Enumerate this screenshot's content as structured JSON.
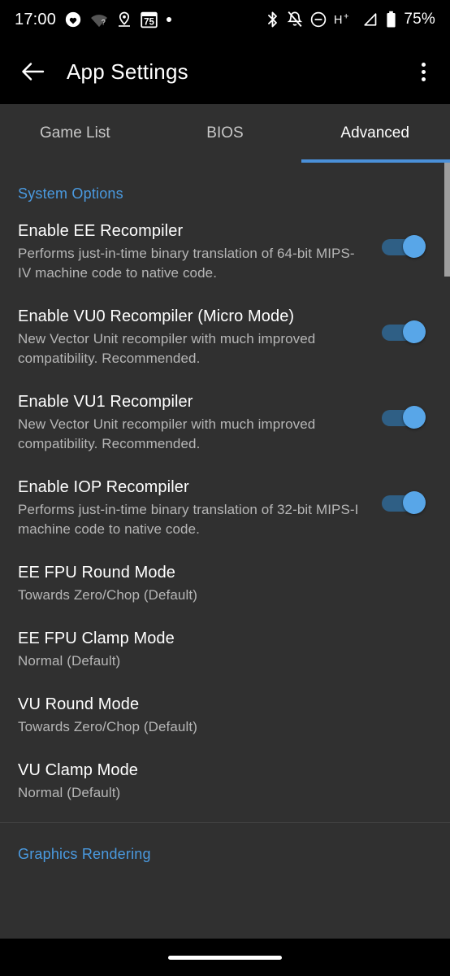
{
  "status_bar": {
    "time": "17:00",
    "battery_percent": "75%",
    "wifi_badge": "?",
    "calendar_day": "75",
    "network_type": "H+",
    "icons_left": [
      "heart-icon",
      "wifi-unknown-icon",
      "location-pin-icon",
      "calendar-icon",
      "dot-icon"
    ],
    "icons_right": [
      "bluetooth-icon",
      "notifications-muted-icon",
      "do-not-disturb-icon",
      "network-type-label",
      "signal-icon",
      "battery-icon"
    ]
  },
  "app_bar": {
    "back_label": "back",
    "title": "App Settings",
    "overflow_label": "more options"
  },
  "tabs": [
    {
      "label": "Game List",
      "active": false
    },
    {
      "label": "BIOS",
      "active": false
    },
    {
      "label": "Advanced",
      "active": true
    }
  ],
  "sections": [
    {
      "header": "System Options",
      "rows": [
        {
          "title": "Enable EE Recompiler",
          "subtitle": "Performs just-in-time binary translation of 64-bit MIPS-IV machine code to native code.",
          "control": "toggle",
          "value": "on"
        },
        {
          "title": "Enable VU0 Recompiler (Micro Mode)",
          "subtitle": "New Vector Unit recompiler with much improved compatibility. Recommended.",
          "control": "toggle",
          "value": "on"
        },
        {
          "title": "Enable VU1 Recompiler",
          "subtitle": "New Vector Unit recompiler with much improved compatibility. Recommended.",
          "control": "toggle",
          "value": "on"
        },
        {
          "title": "Enable IOP Recompiler",
          "subtitle": "Performs just-in-time binary translation of 32-bit MIPS-I machine code to native code.",
          "control": "toggle",
          "value": "on"
        },
        {
          "title": "EE FPU Round Mode",
          "subtitle": "Towards Zero/Chop (Default)",
          "control": "none",
          "value": ""
        },
        {
          "title": "EE FPU Clamp Mode",
          "subtitle": "Normal (Default)",
          "control": "none",
          "value": ""
        },
        {
          "title": "VU Round Mode",
          "subtitle": "Towards Zero/Chop (Default)",
          "control": "none",
          "value": ""
        },
        {
          "title": "VU Clamp Mode",
          "subtitle": "Normal (Default)",
          "control": "none",
          "value": ""
        }
      ]
    },
    {
      "header": "Graphics Rendering",
      "rows": []
    }
  ],
  "colors": {
    "accent": "#4a9ae0",
    "tab_indicator": "#4a90d9",
    "toggle_thumb_on": "#58a6e8",
    "toggle_track_on": "#2f5f85",
    "surface": "#303030",
    "app_bar": "#000000",
    "title_text": "#ffffff",
    "secondary_text": "#b6b6b6",
    "scrollbar": "#9e9e9e"
  }
}
